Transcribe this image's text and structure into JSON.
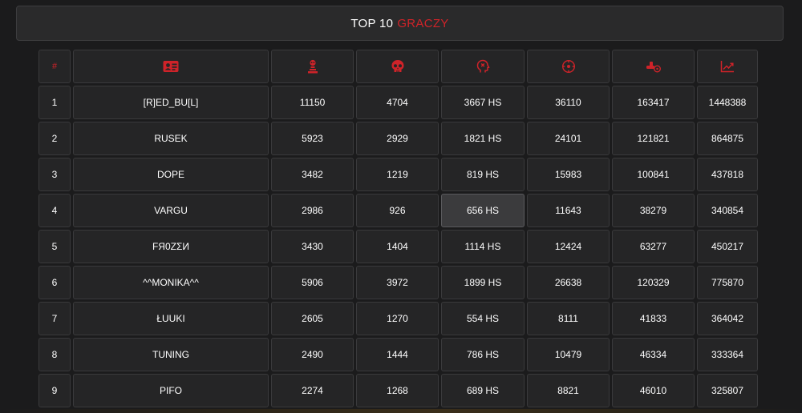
{
  "title": {
    "prefix": "TOP 10",
    "accent": "GRACZY"
  },
  "colors": {
    "accent": "#cf2329",
    "background": "#1b1b1c",
    "cell": "#252526",
    "highlight": "#3b3b3d"
  },
  "headers": [
    {
      "label": "#",
      "icon": null
    },
    {
      "label": "",
      "icon": "id-card-icon"
    },
    {
      "label": "",
      "icon": "kills-trophy-icon"
    },
    {
      "label": "",
      "icon": "skull-icon"
    },
    {
      "label": "",
      "icon": "headshot-head-icon"
    },
    {
      "label": "",
      "icon": "crosshair-target-icon"
    },
    {
      "label": "",
      "icon": "damage-icon"
    },
    {
      "label": "",
      "icon": "chart-trend-icon"
    }
  ],
  "rows": [
    {
      "rank": "1",
      "name": "[R]ED_BU[L]",
      "kills": "11150",
      "deaths": "4704",
      "hs": "3667 HS",
      "shots": "36110",
      "damage": "163417",
      "points": "1448388"
    },
    {
      "rank": "2",
      "name": "RUSEK",
      "kills": "5923",
      "deaths": "2929",
      "hs": "1821 HS",
      "shots": "24101",
      "damage": "121821",
      "points": "864875"
    },
    {
      "rank": "3",
      "name": "DOPE",
      "kills": "3482",
      "deaths": "1219",
      "hs": "819 HS",
      "shots": "15983",
      "damage": "100841",
      "points": "437818"
    },
    {
      "rank": "4",
      "name": "VARGU",
      "kills": "2986",
      "deaths": "926",
      "hs": "656 HS",
      "shots": "11643",
      "damage": "38279",
      "points": "340854"
    },
    {
      "rank": "5",
      "name": "FЯ0ZΣИ",
      "kills": "3430",
      "deaths": "1404",
      "hs": "1114 HS",
      "shots": "12424",
      "damage": "63277",
      "points": "450217"
    },
    {
      "rank": "6",
      "name": "^^MONIKA^^",
      "kills": "5906",
      "deaths": "3972",
      "hs": "1899 HS",
      "shots": "26638",
      "damage": "120329",
      "points": "775870"
    },
    {
      "rank": "7",
      "name": "ŁUUKI",
      "kills": "2605",
      "deaths": "1270",
      "hs": "554 HS",
      "shots": "8111",
      "damage": "41833",
      "points": "364042"
    },
    {
      "rank": "8",
      "name": "TUNING",
      "kills": "2490",
      "deaths": "1444",
      "hs": "786 HS",
      "shots": "10479",
      "damage": "46334",
      "points": "333364"
    },
    {
      "rank": "9",
      "name": "PIFO",
      "kills": "2274",
      "deaths": "1268",
      "hs": "689 HS",
      "shots": "8821",
      "damage": "46010",
      "points": "325807"
    }
  ],
  "highlighted_cell": {
    "row": 4,
    "column": "hs"
  }
}
